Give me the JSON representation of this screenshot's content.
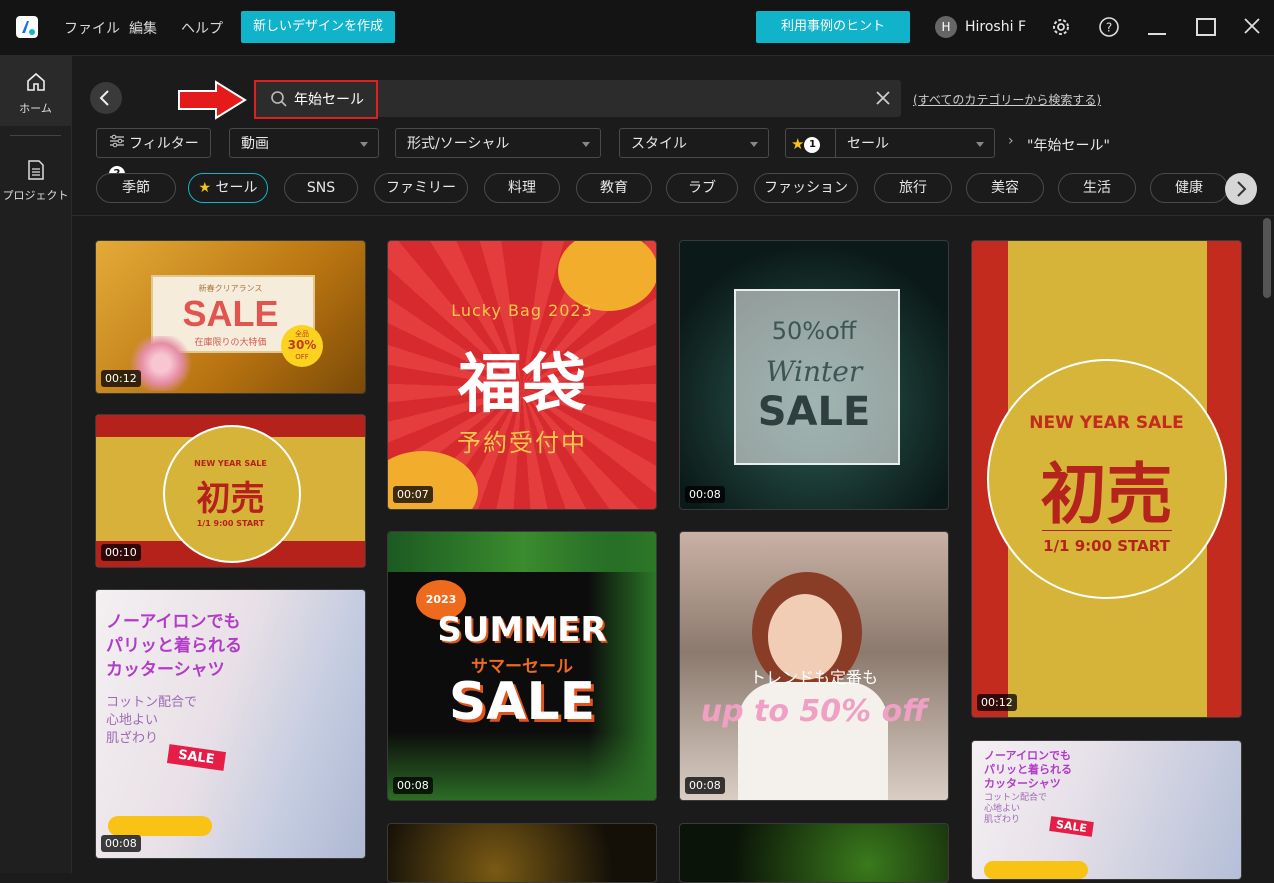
{
  "topbar": {
    "menu": [
      "ファイル",
      "編集",
      "ヘルプ"
    ],
    "create_btn": "新しいデザインを作成",
    "hint_btn": "利用事例のヒント",
    "avatar_letter": "H",
    "user_name": "Hiroshi F"
  },
  "sidebar": {
    "home": "ホーム",
    "project": "プロジェクト"
  },
  "search": {
    "value": "年始セール",
    "all_categories_link": "(すべてのカテゴリーから検索する)"
  },
  "filters": {
    "filter_label": "フィルター",
    "filter_count": "2",
    "type": "動画",
    "format": "形式/ソーシャル",
    "style": "スタイル",
    "fav_count": "1",
    "category": "セール",
    "breadcrumb": "\"年始セール\""
  },
  "categories": [
    "季節",
    "セール",
    "SNS",
    "ファミリー",
    "料理",
    "教育",
    "ラブ",
    "ファッション",
    "旅行",
    "美容",
    "生活",
    "健康"
  ],
  "cards": [
    {
      "duration": "00:12",
      "t1": "新春クリアランス",
      "t2": "SALE",
      "t3": "在庫限りの大特価",
      "t4": "全品",
      "t5": "30%",
      "t6": "OFF"
    },
    {
      "duration": "00:10",
      "t1": "NEW YEAR SALE",
      "t2": "初売",
      "t3": "1/1 9:00 START"
    },
    {
      "duration": "00:08",
      "t1": "ノーアイロンでも",
      "t2": "パリッと着られる",
      "t3": "カッターシャツ",
      "t4": "コットン配合で",
      "t5": "心地よい",
      "t6": "肌ざわり",
      "t7": "SALE"
    },
    {
      "duration": "00:07",
      "t1": "Lucky Bag 2023",
      "t2": "福袋",
      "t3": "予約受付中"
    },
    {
      "duration": "00:08",
      "t1": "2023",
      "t2": "SUMMER",
      "t3": "サマーセール",
      "t4": "SALE"
    },
    {
      "duration": "00:08",
      "t1": "50%off",
      "t2": "Winter",
      "t3": "SALE"
    },
    {
      "duration": "00:08",
      "t1": "トレンドも定番も",
      "t2": "up to 50% off"
    },
    {
      "duration": "00:12",
      "t1": "NEW YEAR SALE",
      "t2": "初売",
      "t3": "1/1 9:00 START"
    },
    {
      "t1": "ノーアイロンでも",
      "t2": "パリッと着られる",
      "t3": "カッターシャツ",
      "t4": "コットン配合で",
      "t5": "心地よい",
      "t6": "肌ざわり",
      "t7": "SALE"
    }
  ]
}
